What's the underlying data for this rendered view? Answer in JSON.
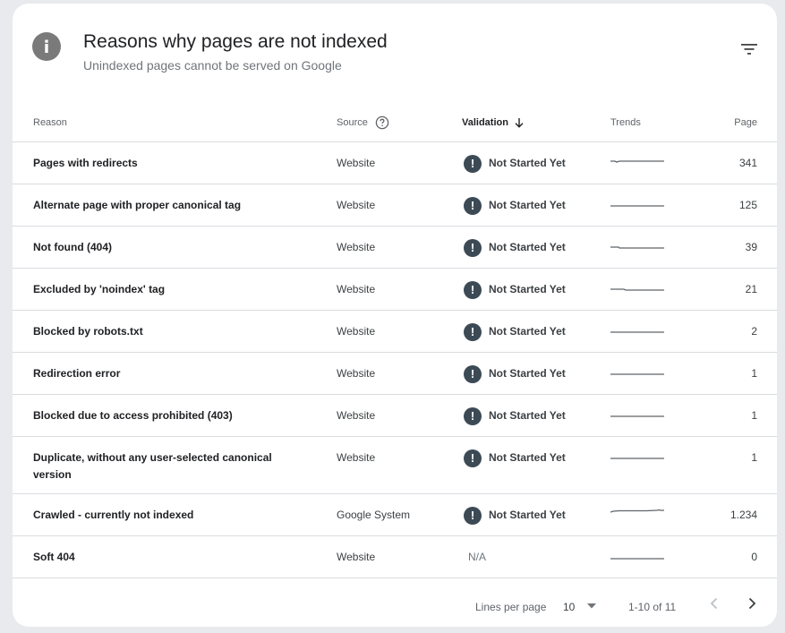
{
  "header": {
    "title": "Reasons why pages are not indexed",
    "subtitle": "Unindexed pages cannot be served on Google"
  },
  "columns": {
    "reason": "Reason",
    "source": "Source",
    "validation": "Validation",
    "trends": "Trends",
    "pages": "Page"
  },
  "rows": [
    {
      "reason": "Pages with redirects",
      "source": "Website",
      "validation": "Not Started Yet",
      "pages": "341"
    },
    {
      "reason": "Alternate page with proper canonical tag",
      "source": "Website",
      "validation": "Not Started Yet",
      "pages": "125"
    },
    {
      "reason": "Not found (404)",
      "source": "Website",
      "validation": "Not Started Yet",
      "pages": "39"
    },
    {
      "reason": "Excluded by 'noindex' tag",
      "source": "Website",
      "validation": "Not Started Yet",
      "pages": "21"
    },
    {
      "reason": "Blocked by robots.txt",
      "source": "Website",
      "validation": "Not Started Yet",
      "pages": "2"
    },
    {
      "reason": "Redirection error",
      "source": "Website",
      "validation": "Not Started Yet",
      "pages": "1"
    },
    {
      "reason": "Blocked due to access prohibited (403)",
      "source": "Website",
      "validation": "Not Started Yet",
      "pages": "1"
    },
    {
      "reason": "Duplicate, without any user-selected canonical version",
      "source": "Website",
      "validation": "Not Started Yet",
      "pages": "1"
    },
    {
      "reason": "Crawled - currently not indexed",
      "source": "Google System",
      "validation": "Not Started Yet",
      "pages": "1.234"
    },
    {
      "reason": "Soft 404",
      "source": "Website",
      "validation": "N/A",
      "pages": "0"
    }
  ],
  "footer": {
    "lines_per_page_label": "Lines per page",
    "lines_per_page_value": "10",
    "range": "1-10 of 11"
  },
  "icons": {
    "header": "info-icon",
    "filter": "filter-icon",
    "source_help": "help-icon",
    "sort": "arrow-down-icon",
    "validation_status": "exclamation-icon",
    "prev": "chevron-left-icon",
    "next": "chevron-right-icon"
  },
  "colors": {
    "status_icon": "#3c4a55",
    "info_icon": "#7a7a7a",
    "sparkline": "#5f6368"
  }
}
